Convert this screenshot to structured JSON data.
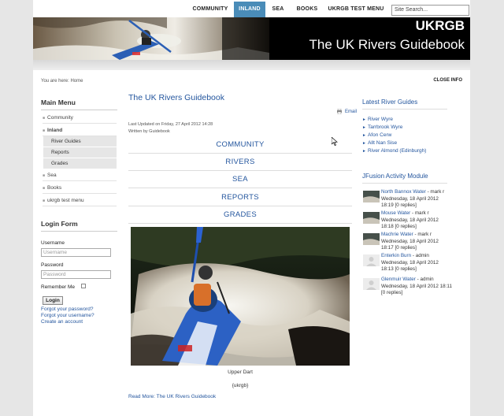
{
  "nav": {
    "items": [
      {
        "label": "COMMUNITY",
        "active": false
      },
      {
        "label": "INLAND",
        "active": true
      },
      {
        "label": "SEA",
        "active": false
      },
      {
        "label": "BOOKS",
        "active": false
      },
      {
        "label": "UKRGB TEST MENU",
        "active": false
      }
    ],
    "search_placeholder": "Site Search..."
  },
  "banner": {
    "title": "UKRGB",
    "subtitle": "The UK Rivers Guidebook"
  },
  "breadcrumb": "You are here: Home",
  "close_info": "CLOSE INFO",
  "main_menu": {
    "heading": "Main Menu",
    "items": [
      "Community",
      "Inland",
      "Sea",
      "Books",
      "ukrgb test menu"
    ],
    "submenu": [
      "River Guides",
      "Reports",
      "Grades"
    ]
  },
  "login_form": {
    "heading": "Login Form",
    "username_label": "Username",
    "username_placeholder": "Username",
    "password_label": "Password",
    "password_placeholder": "Password",
    "remember_label": "Remember Me",
    "login_button": "Login",
    "forgot_password": "Forgot your password?",
    "forgot_username": "Forgot your username?",
    "create_account": "Create an account"
  },
  "article": {
    "title": "The UK Rivers Guidebook",
    "email_label": "Email",
    "last_updated": "Last Updated on Friday, 27 April 2012 14:28",
    "written_by": "Written by Guidebook",
    "sections": [
      "COMMUNITY",
      "RIVERS",
      "SEA",
      "REPORTS",
      "GRADES"
    ],
    "caption": "Upper Dart",
    "credit": "{ukrgb}",
    "read_more": "Read More: The UK Rivers Guidebook"
  },
  "latest_guides": {
    "heading": "Latest River Guides",
    "items": [
      "River Wyre",
      "Tarrbrook Wyre",
      "Afon Cerw",
      "Allt Nan Sise",
      "River Almond (Edinburgh)"
    ]
  },
  "activity": {
    "heading": "JFusion Activity Module",
    "items": [
      {
        "topic": "North Bannox Water",
        "author": "- mark r",
        "date": "Wednesday, 18 April 2012 18:19",
        "replies": "[0 replies]"
      },
      {
        "topic": "Mouse Water",
        "author": "- mark r",
        "date": "Wednesday, 18 April 2012 18:18",
        "replies": "[0 replies]"
      },
      {
        "topic": "Machrie Water",
        "author": "- mark r",
        "date": "Wednesday, 18 April 2012 18:17",
        "replies": "[0 replies]"
      },
      {
        "topic": "Enterkin Burn",
        "author": "- admin",
        "date": "Wednesday, 18 April 2012 18:13",
        "replies": "[0 replies]"
      },
      {
        "topic": "Glenmuir Water",
        "author": "- admin",
        "date": "Wednesday, 18 April 2012 18:11",
        "replies": "[0 replies]"
      }
    ]
  },
  "colors": {
    "accent": "#4a8cb8",
    "link": "#24569e",
    "background": "#e6e6e6"
  }
}
